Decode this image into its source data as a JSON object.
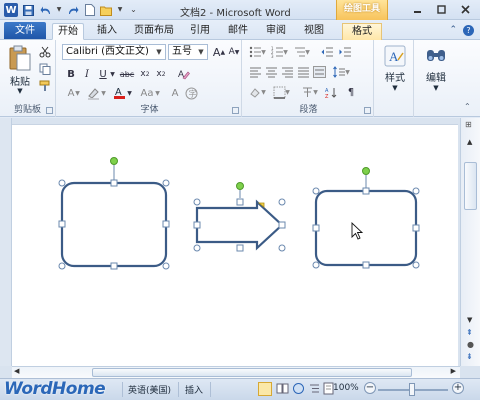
{
  "titlebar": {
    "title": "文档2 - Microsoft Word",
    "context_tools": "绘图工具"
  },
  "tabs": {
    "file": "文件",
    "items": [
      "开始",
      "插入",
      "页面布局",
      "引用",
      "邮件",
      "审阅",
      "视图",
      "格式"
    ]
  },
  "ribbon": {
    "clipboard": {
      "paste": "粘贴",
      "label": "剪贴板"
    },
    "font": {
      "name": "Calibri (西文正文)",
      "size": "五号",
      "label": "字体"
    },
    "paragraph": {
      "label": "段落"
    },
    "styles": {
      "label": "样式"
    },
    "editing": {
      "label": "编辑"
    }
  },
  "statusbar": {
    "watermark": "WordHome",
    "language": "英语(美国)",
    "mode": "插入",
    "zoom": "100%",
    "zoom_value": 1.0
  },
  "colors": {
    "shape_stroke": "#3b5b86",
    "handle_green": "#7ed04b",
    "file_tab": "#2b63b6",
    "context_tools": "#f5c05a"
  },
  "icons": [
    "word-icon",
    "save-icon",
    "undo-icon",
    "redo-icon",
    "new-doc-icon",
    "open-icon",
    "minimize-icon",
    "maximize-icon",
    "close-icon",
    "help-icon",
    "paste-icon",
    "cut-icon",
    "copy-icon",
    "format-painter-icon",
    "styles-icon",
    "find-icon",
    "cursor-icon"
  ]
}
